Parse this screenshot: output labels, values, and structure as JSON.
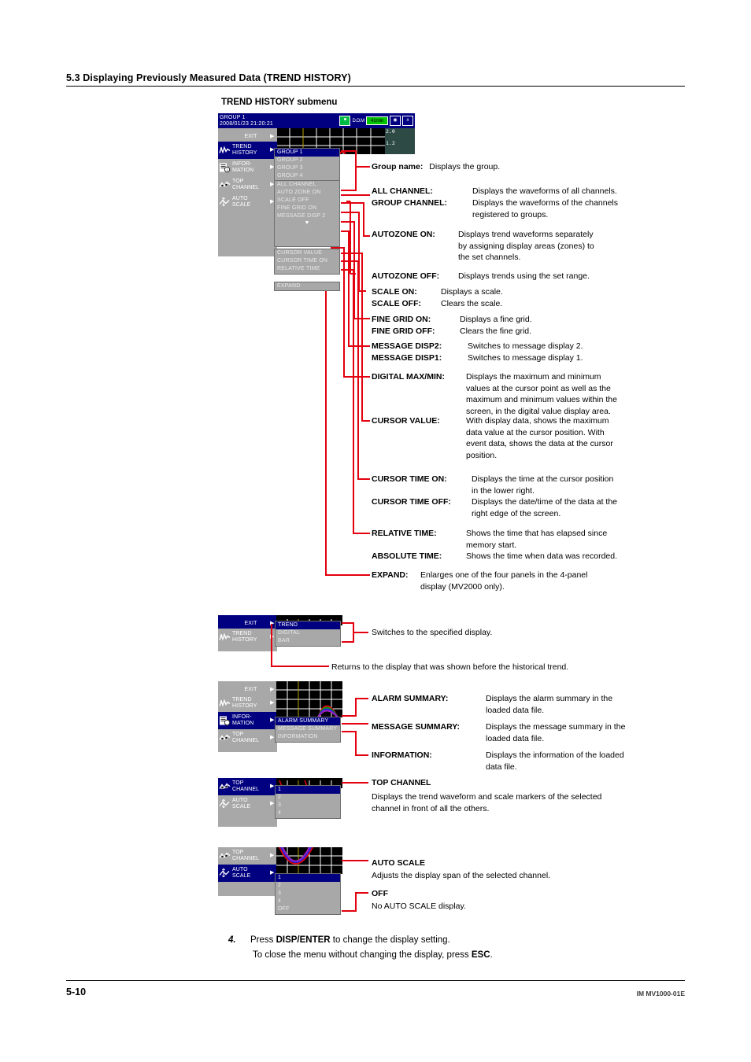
{
  "page": {
    "section_title": "5.3  Displaying Previously Measured Data (TREND HISTORY)",
    "figure_caption": "TREND HISTORY submenu",
    "footer_page": "5-10",
    "footer_doc": "IM MV1000-01E"
  },
  "device_main": {
    "titlebar": {
      "group": "GROUP 1",
      "timestamp": "2008/01/23 21:20:21",
      "status_label": "D.O.M",
      "chip": "41min"
    },
    "scale_markers": [
      "2.0",
      "1.2"
    ],
    "sidebar": [
      {
        "label": "EXIT",
        "icon": "none",
        "arrow": "▶",
        "selected": false
      },
      {
        "label": "TREND\nHISTORY",
        "icon": "trend-icon",
        "arrow": "▶",
        "selected": true
      },
      {
        "label": "INFOR-\nMATION",
        "icon": "information-icon",
        "arrow": "▶",
        "selected": false
      },
      {
        "label": "TOP\nCHANNEL",
        "icon": "top-channel-icon",
        "arrow": "▶",
        "selected": false
      },
      {
        "label": "AUTO\nSCALE",
        "icon": "auto-scale-icon",
        "arrow": "▶",
        "selected": false
      }
    ],
    "popup_top": [
      {
        "label": "GROUP 1",
        "selected": true
      },
      {
        "label": "GROUP 2",
        "selected": false
      },
      {
        "label": "GROUP 3",
        "selected": false
      },
      {
        "label": "GROUP 4",
        "selected": false
      }
    ],
    "popup_mid": [
      {
        "label": "ALL CHANNEL"
      },
      {
        "label": "AUTO ZONE ON"
      },
      {
        "label": "SCALE OFF"
      },
      {
        "label": "FINE GRID ON"
      },
      {
        "label": "MESSAGE DISP 2"
      }
    ],
    "popup_caret": "▼",
    "popup_low": [
      {
        "label": "CURSOR VALUE"
      },
      {
        "label": "CURSOR TIME ON"
      },
      {
        "label": "RELATIVE TIME"
      }
    ],
    "popup_expand": {
      "label": "EXPAND"
    }
  },
  "device_display": {
    "sidebar": [
      {
        "label": "EXIT",
        "icon": "none",
        "arrow": "▶",
        "selected": true
      },
      {
        "label": "TREND\nHISTORY",
        "icon": "trend-icon",
        "arrow": "▶",
        "selected": false
      }
    ],
    "popup": [
      {
        "label": "TREND",
        "selected": true
      },
      {
        "label": "DIGITAL",
        "selected": false
      },
      {
        "label": "BAR",
        "selected": false
      }
    ]
  },
  "device_information": {
    "sidebar": [
      {
        "label": "EXIT",
        "icon": "none",
        "arrow": "▶",
        "selected": false
      },
      {
        "label": "TREND\nHISTORY",
        "icon": "trend-icon",
        "arrow": "▶",
        "selected": false
      },
      {
        "label": "INFOR-\nMATION",
        "icon": "information-icon",
        "arrow": "▶",
        "selected": true
      },
      {
        "label": "TOP\nCHANNEL",
        "icon": "top-channel-icon",
        "arrow": "▶",
        "selected": false
      }
    ],
    "popup": [
      {
        "label": "ALARM SUMMARY",
        "selected": true
      },
      {
        "label": "MESSAGE SUMMARY",
        "selected": false
      },
      {
        "label": "INFORMATION",
        "selected": false
      }
    ]
  },
  "device_top_channel": {
    "sidebar": [
      {
        "label": "TOP\nCHANNEL",
        "icon": "top-channel-icon",
        "arrow": "▶",
        "selected": true
      },
      {
        "label": "AUTO\nSCALE",
        "icon": "auto-scale-icon",
        "arrow": "▶",
        "selected": false
      }
    ],
    "popup": [
      {
        "label": "1",
        "selected": true
      },
      {
        "label": "2",
        "selected": false
      },
      {
        "label": "3",
        "selected": false
      },
      {
        "label": "4",
        "selected": false
      }
    ]
  },
  "device_auto_scale": {
    "sidebar": [
      {
        "label": "TOP\nCHANNEL",
        "icon": "top-channel-icon",
        "arrow": "▶",
        "selected": false
      },
      {
        "label": "AUTO\nSCALE",
        "icon": "auto-scale-icon",
        "arrow": "▶",
        "selected": true
      }
    ],
    "popup": [
      {
        "label": "1",
        "selected": true
      },
      {
        "label": "2",
        "selected": false
      },
      {
        "label": "3",
        "selected": false
      },
      {
        "label": "4",
        "selected": false
      },
      {
        "label": "OFF",
        "selected": false
      }
    ]
  },
  "annotations": {
    "group_name": {
      "term": "Group name:",
      "desc": "Displays the group."
    },
    "all_channel": {
      "term": "ALL CHANNEL:",
      "desc": "Displays the waveforms of all channels."
    },
    "group_channel": {
      "term": "GROUP CHANNEL:",
      "desc": "Displays the waveforms of the channels\nregistered to groups."
    },
    "autozone_on": {
      "term": "AUTOZONE ON:",
      "desc": "Displays trend waveforms separately\nby assigning display areas (zones) to\nthe set channels."
    },
    "autozone_off": {
      "term": "AUTOZONE OFF:",
      "desc": "Displays trends using the set range."
    },
    "scale_on": {
      "term": "SCALE ON:",
      "desc": "Displays a scale."
    },
    "scale_off": {
      "term": "SCALE OFF:",
      "desc": "Clears the scale."
    },
    "fine_grid_on": {
      "term": "FINE GRID ON:",
      "desc": "Displays a fine grid."
    },
    "fine_grid_off": {
      "term": "FINE GRID OFF:",
      "desc": "Clears the fine grid."
    },
    "message_disp2": {
      "term": "MESSAGE DISP2:",
      "desc": "Switches to message display 2."
    },
    "message_disp1": {
      "term": "MESSAGE DISP1:",
      "desc": "Switches to message display 1."
    },
    "digital_maxmin": {
      "term": "DIGITAL MAX/MIN:",
      "desc": "Displays the maximum and minimum\nvalues at the cursor point as well as the\nmaximum and minimum values within the\nscreen, in the digital value display area."
    },
    "cursor_value": {
      "term": "CURSOR VALUE:",
      "desc": "With display data, shows the maximum\ndata value at the cursor position. With\nevent data, shows the data at the cursor\nposition."
    },
    "cursor_time_on": {
      "term": "CURSOR TIME ON:",
      "desc": "Displays the time at the cursor position\nin the lower right."
    },
    "cursor_time_off": {
      "term": "CURSOR TIME OFF:",
      "desc": "Displays the date/time of the data at the\nright edge of the screen."
    },
    "relative_time": {
      "term": "RELATIVE TIME:",
      "desc": "Shows the time that has elapsed since\nmemory start."
    },
    "absolute_time": {
      "term": "ABSOLUTE TIME:",
      "desc": "Shows the time when data was recorded."
    },
    "expand": {
      "term": "EXPAND:",
      "desc": "Enlarges one of the four panels in the 4-panel\ndisplay (MV2000 only)."
    },
    "switches_display": {
      "desc": "Switches to the specified display."
    },
    "returns_display": {
      "desc": "Returns to the display that was shown before the historical trend."
    },
    "alarm_summary": {
      "term": "ALARM SUMMARY:",
      "desc": "Displays the alarm summary in the\nloaded data file."
    },
    "message_summary": {
      "term": "MESSAGE SUMMARY:",
      "desc": "Displays the message summary in the\nloaded data file."
    },
    "information": {
      "term": "INFORMATION:",
      "desc": "Displays the information of the loaded\ndata file."
    },
    "top_channel_head": {
      "term": "TOP CHANNEL"
    },
    "top_channel_body": {
      "desc": "Displays the trend waveform and scale markers of the selected\nchannel in front of all the others."
    },
    "auto_scale_head": {
      "term": "AUTO SCALE"
    },
    "auto_scale_body": {
      "desc": "Adjusts the display span of the selected channel."
    },
    "off_head": {
      "term": "OFF"
    },
    "off_body": {
      "desc": "No AUTO SCALE display."
    }
  },
  "step4": {
    "number": "4.",
    "line1_pre": "Press ",
    "line1_bold": "DISP/ENTER",
    "line1_post": " to change the display setting.",
    "line2_pre": "To close the menu without changing the display, press ",
    "line2_bold": "ESC",
    "line2_post": "."
  },
  "colors": {
    "accent_red": "#e3000f",
    "menu_gray": "#a8a8a8",
    "select_blue": "#000080",
    "scale_panel": "#2d4a44"
  }
}
